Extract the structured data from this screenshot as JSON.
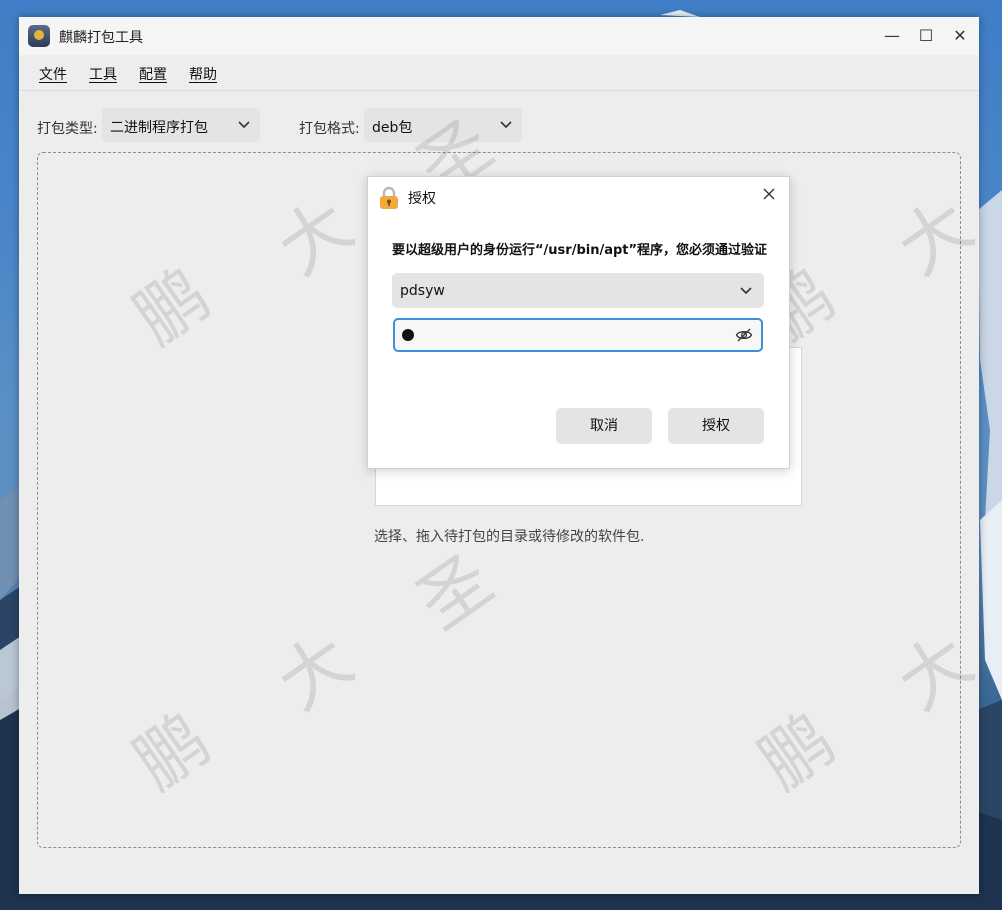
{
  "window": {
    "title": "麒麟打包工具",
    "minimize_glyph": "—",
    "maximize_glyph": "☐",
    "close_glyph": "✕"
  },
  "menu": [
    "文件",
    "工具",
    "配置",
    "帮助"
  ],
  "toolbar": {
    "package_type_label": "打包类型:",
    "package_type_value": "二进制程序打包",
    "package_format_label": "打包格式:",
    "package_format_value": "deb包"
  },
  "dropzone": {
    "hint": "选择、拖入待打包的目录或待修改的软件包."
  },
  "watermark": [
    "鹏",
    "大",
    "圣"
  ],
  "dialog": {
    "title": "授权",
    "message": "要以超级用户的身份运行“/usr/bin/apt”程序，您必须通过验证",
    "user": "pdsyw",
    "cancel_label": "取消",
    "authorize_label": "授权",
    "icons": [
      "lock-icon",
      "close-icon",
      "chevron-down-icon",
      "eye-off-icon"
    ]
  },
  "colors": {
    "focus_border": "#3d8fd8",
    "lock_body": "#f2a93b"
  }
}
